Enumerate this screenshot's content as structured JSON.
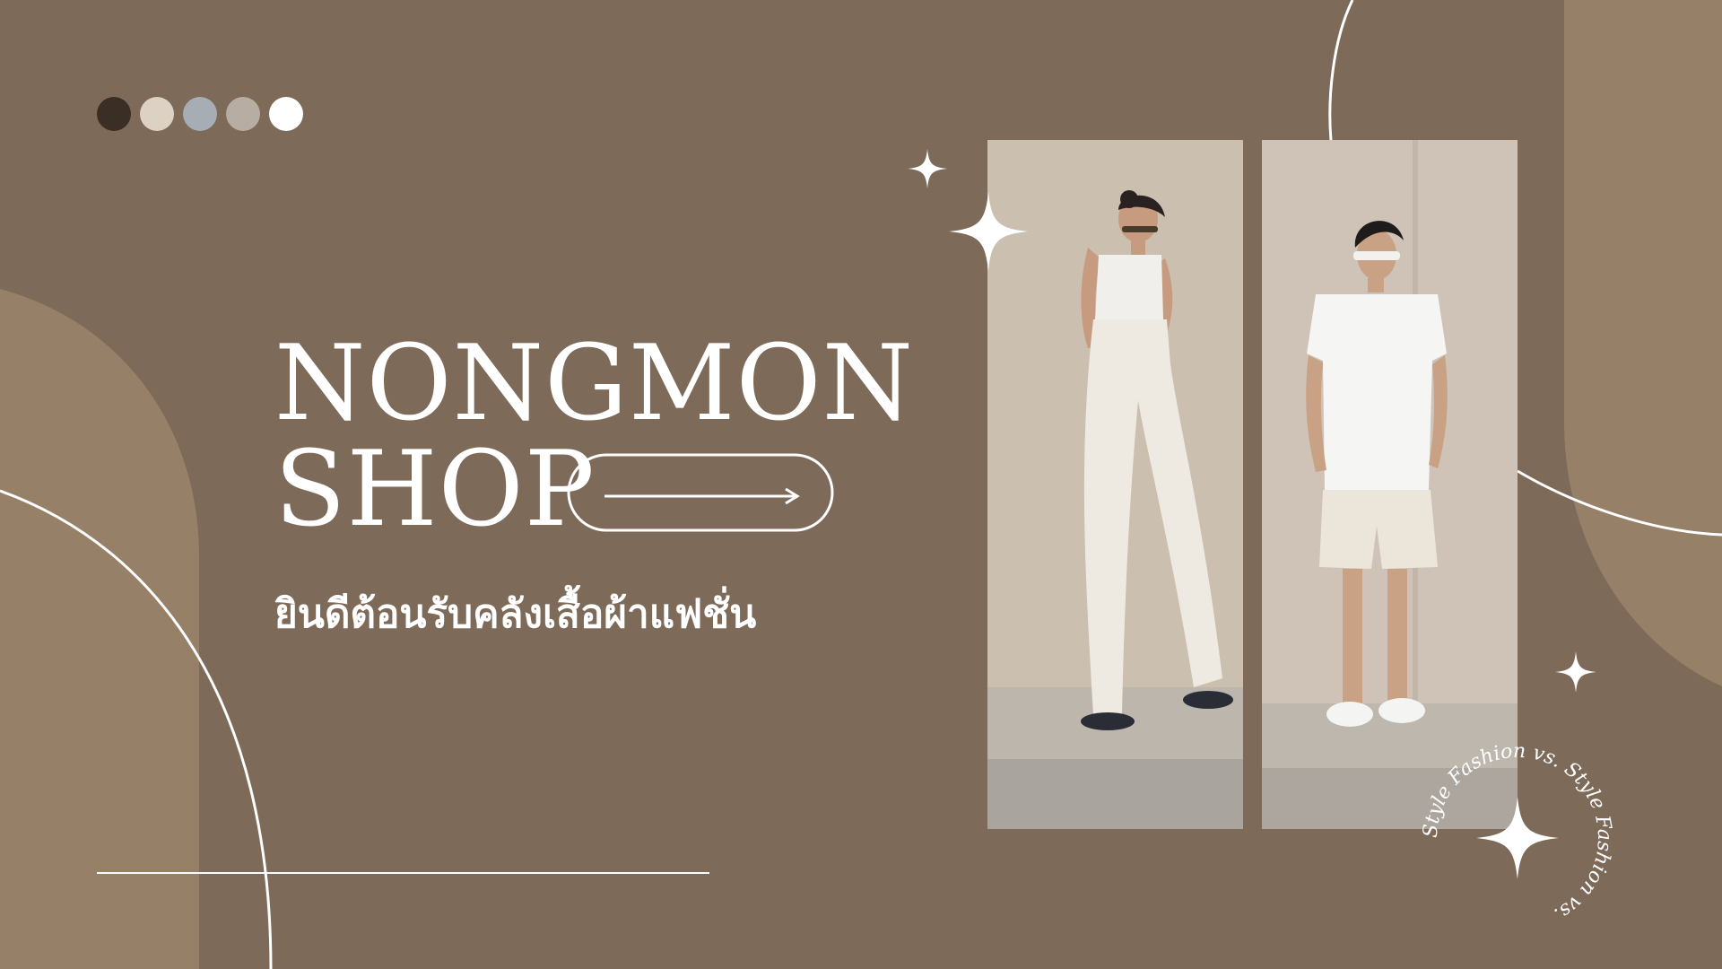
{
  "colors": {
    "background": "#7d6a59",
    "shape_light": "#978068",
    "line": "#ffffff",
    "text": "#ffffff"
  },
  "palette_dots": [
    "#3b2e25",
    "#ddd1c4",
    "#a6adb4",
    "#b8ada2",
    "#ffffff"
  ],
  "brand": {
    "line1": "NONGMON",
    "line2": "SHOP"
  },
  "subtitle": "ยินดีต้อนรับคลังเสื้อผ้าแฟชั่น",
  "badge_text": "Style Fashion vs. Style Fashion vs. ",
  "photos": [
    {
      "name": "photo-woman",
      "subject": "woman in white tank top and cream wide-leg trousers"
    },
    {
      "name": "photo-man",
      "subject": "man in white short-sleeve shirt and cream shorts"
    }
  ],
  "icons": [
    "sparkle-icon",
    "arrow-right-icon"
  ]
}
